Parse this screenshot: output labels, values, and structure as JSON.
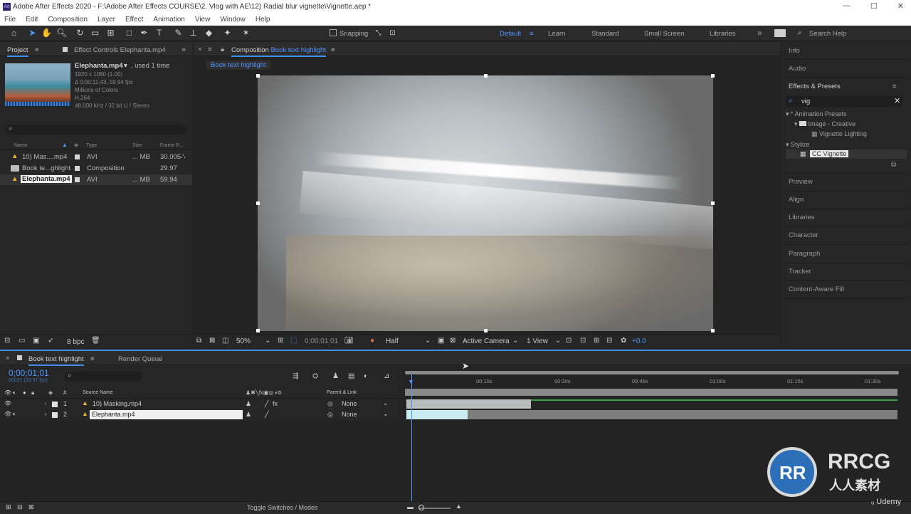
{
  "window": {
    "title": "Adobe After Effects 2020 - F:\\Adobe After Effects COURSE\\2. Vlog with AE\\12) Radial blur vignette\\Vignette.aep *",
    "app_icon": "Ae",
    "controls": [
      "—",
      "☐",
      "✕"
    ]
  },
  "menu": [
    "File",
    "Edit",
    "Composition",
    "Layer",
    "Effect",
    "Animation",
    "View",
    "Window",
    "Help"
  ],
  "toolbar": {
    "snapping_label": "Snapping",
    "workspaces": [
      "Default",
      "Learn",
      "Standard",
      "Small Screen",
      "Libraries"
    ],
    "active_workspace": "Default",
    "more": "»",
    "search_help_placeholder": "Search Help"
  },
  "project_panel": {
    "tab_project": "Project",
    "tab_effect_controls": "Effect Controls Elephanta.mp4",
    "selected": {
      "name": "Elephanta.mp4",
      "used": ", used 1 time",
      "resolution": "1920 x 1080 (1.00)",
      "duration": "Δ 0;00;11;43, 59.94 fps",
      "colors": "Millions of Colors",
      "codec": "H.264",
      "audio": "48.000 kHz / 32 bit U / Stereo"
    },
    "search_icon": "search-icon",
    "columns": [
      "Name",
      "Type",
      "Size",
      "Frame R..."
    ],
    "items": [
      {
        "name": "10) Mas....mp4",
        "type": "AVI",
        "size": "... MB",
        "fps": "30.005"
      },
      {
        "name": "Book te...ghlight",
        "type": "Composition",
        "size": "",
        "fps": "29.97"
      },
      {
        "name": "Elephanta.mp4",
        "type": "AVI",
        "size": "... MB",
        "fps": "59.94"
      }
    ],
    "bpc": "8 bpc"
  },
  "composition_panel": {
    "tab": "Composition",
    "comp_name": "Book text highlight",
    "breadcrumb": "Book text highlight",
    "zoom": "50%",
    "timecode": "0;00;01;01",
    "resolution": "Half",
    "camera": "Active Camera",
    "views": "1 View",
    "exposure": "+0.0"
  },
  "right_panel": {
    "info": "Info",
    "audio": "Audio",
    "effects_presets": "Effects & Presets",
    "search_value": "vig",
    "tree": [
      {
        "label": "* Animation Presets",
        "level": 0
      },
      {
        "label": "Image - Creative",
        "level": 1
      },
      {
        "label": "Vignette Lighting",
        "level": 2
      },
      {
        "label": "Stylize",
        "level": 0
      },
      {
        "label": "CC Vignette",
        "level": 1
      }
    ],
    "panels": [
      "Preview",
      "Align",
      "Libraries",
      "Character",
      "Paragraph",
      "Tracker",
      "Content-Aware Fill"
    ]
  },
  "timeline": {
    "tab": "Book text highlight",
    "render_queue": "Render Queue",
    "timecode": "0;00;01;01",
    "frame_info": "00031 (29.97 fps)",
    "columns": {
      "source": "Source Name",
      "parent": "Parent & Link"
    },
    "layers": [
      {
        "num": "1",
        "name": "10) Masking.mp4",
        "parent": "None"
      },
      {
        "num": "2",
        "name": "Elephanta.mp4",
        "parent": "None"
      }
    ],
    "ruler": [
      "0s",
      "00:15s",
      "00:30s",
      "00:45s",
      "01:00s",
      "01:15s",
      "01:30s"
    ],
    "toggle_label": "Toggle Switches / Modes"
  },
  "watermark": {
    "brand": "RRCG",
    "sub": "人人素材",
    "udemy": "Udemy"
  }
}
